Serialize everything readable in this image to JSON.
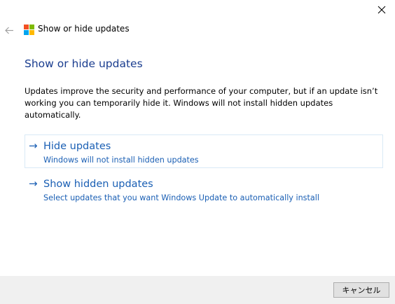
{
  "window": {
    "title": "Show or hide updates",
    "close_icon": "close-icon",
    "back_icon": "back-arrow-icon",
    "logo_icon": "windows-logo-icon"
  },
  "main": {
    "heading": "Show or hide updates",
    "description": "Updates improve the security and performance of your computer, but if an update isn’t working you can temporarily hide it. Windows will not install hidden updates automatically.",
    "options": [
      {
        "arrow": "→",
        "title": "Hide updates",
        "subtitle": "Windows will not install hidden updates"
      },
      {
        "arrow": "→",
        "title": "Show hidden updates",
        "subtitle": "Select updates that you want Windows Update to automatically install"
      }
    ]
  },
  "footer": {
    "cancel_label": "キャンセル"
  },
  "colors": {
    "heading": "#1a3d8f",
    "link": "#1a5fb4",
    "footer_bg": "#f0f0f0",
    "logo": [
      "#f25022",
      "#7fba00",
      "#00a4ef",
      "#ffb900"
    ]
  }
}
